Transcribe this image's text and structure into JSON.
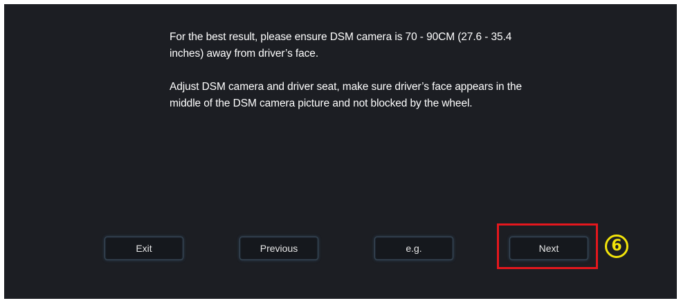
{
  "instructions": {
    "paragraph_1": "For the best result, please ensure DSM camera is 70 - 90CM (27.6 - 35.4 inches) away from driver’s face.",
    "paragraph_2": "Adjust DSM camera and driver seat, make sure driver’s face appears in the middle of the DSM camera picture and not blocked by the wheel."
  },
  "buttons": {
    "exit": "Exit",
    "previous": "Previous",
    "example": "e.g.",
    "next": "Next"
  },
  "annotation": {
    "step_number": "6",
    "highlight_color": "#e5171d",
    "marker_color": "#f2e40a"
  },
  "colors": {
    "background": "#1c1e23",
    "button_border": "#3b4a58"
  }
}
